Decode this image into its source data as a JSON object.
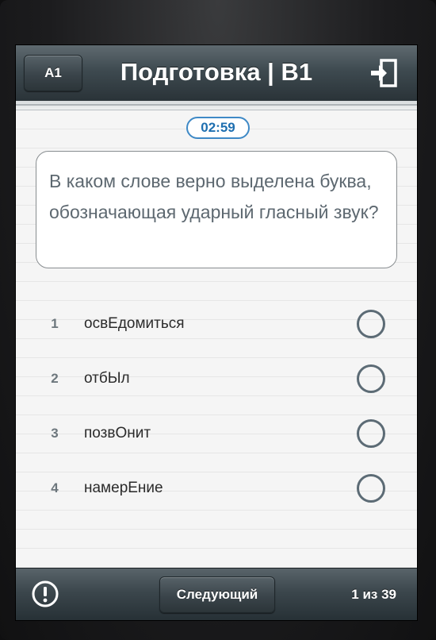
{
  "header": {
    "back_label": "A1",
    "title": "Подготовка | B1",
    "exit_icon": "exit-icon"
  },
  "timer": {
    "value": "02:59"
  },
  "question": {
    "text": "В каком слове верно выделена буква, обозначающая ударный гласный звук?"
  },
  "answers": [
    {
      "number": "1",
      "text": "освЕдомиться",
      "selected": false
    },
    {
      "number": "2",
      "text": "отбЫл",
      "selected": false
    },
    {
      "number": "3",
      "text": "позвОнит",
      "selected": false
    },
    {
      "number": "4",
      "text": "намерЕние",
      "selected": false
    }
  ],
  "footer": {
    "info_icon": "info-icon",
    "next_label": "Следующий",
    "progress": "1 из 39"
  },
  "colors": {
    "accent": "#3e89c6",
    "bar": "#3e4a50",
    "radio": "#5c6b75"
  }
}
